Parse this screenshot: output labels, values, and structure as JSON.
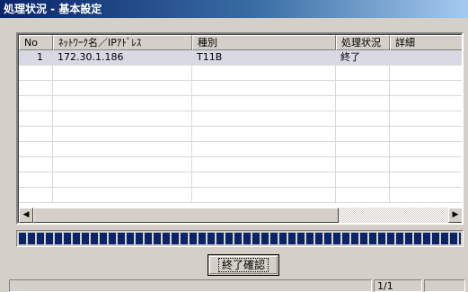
{
  "window": {
    "title": "処理状況 - 基本設定"
  },
  "list": {
    "columns": [
      {
        "label": "No"
      },
      {
        "label": "ﾈｯﾄﾜｰｸ名／IPｱﾄﾞﾚｽ"
      },
      {
        "label": "種別"
      },
      {
        "label": "処理状況"
      },
      {
        "label": "詳細"
      }
    ],
    "rows": [
      {
        "no": "1",
        "network": "172.30.1.186",
        "type": "T11B",
        "status": "終了",
        "detail": ""
      }
    ]
  },
  "progress": {
    "value": 1.0,
    "color": "#0a246a"
  },
  "buttons": {
    "confirm_label": "終了確認"
  },
  "statusbar": {
    "main": "",
    "page": "1/1",
    "extra": ""
  },
  "colors": {
    "titlebar_start": "#0a246a",
    "titlebar_end": "#a6caf0",
    "face": "#d4d0c8",
    "selected_row": "#d9d9e4"
  }
}
